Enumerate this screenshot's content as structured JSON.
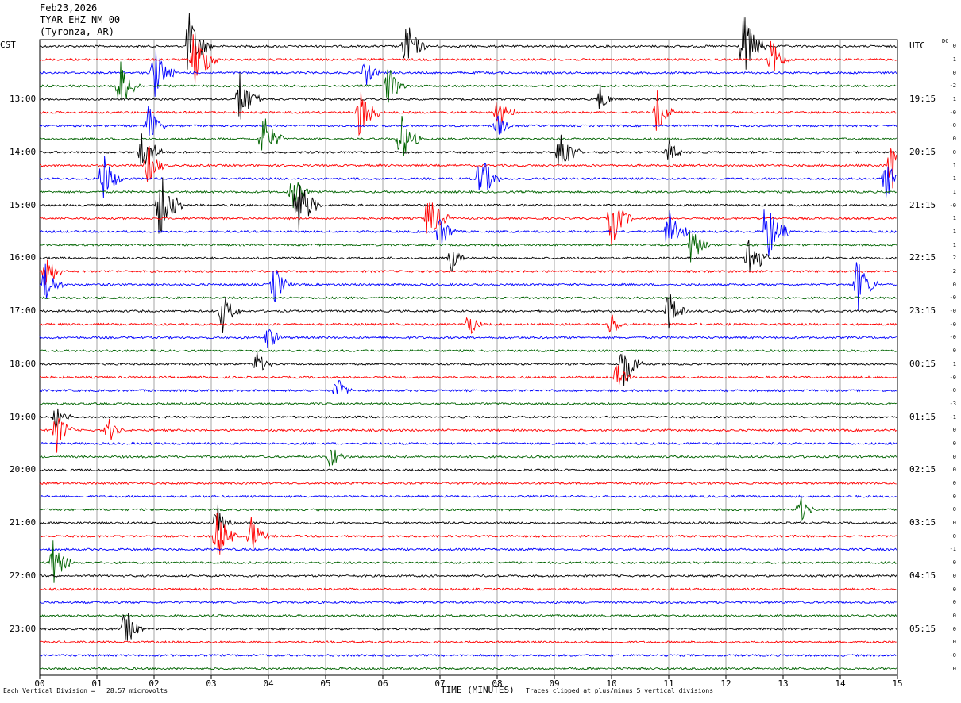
{
  "header": {
    "date": "Feb23,2026",
    "station": "TYAR EHZ NM 00",
    "location": "(Tyronza, AR)"
  },
  "left_tz": "CST",
  "right_tz": "UTC",
  "dc_label": "DC",
  "footer": {
    "scale": "Each Vertical Division =   28.57 microvolts",
    "xaxis_title": "TIME (MINUTES)",
    "clip_note": "Traces clipped at plus/minus 5 vertical divisions"
  },
  "colors": {
    "trace_cycle": [
      "#000000",
      "#ff0000",
      "#0000ff",
      "#006400"
    ],
    "grid": "#808080",
    "frame": "#000000"
  },
  "chart_data": {
    "type": "line",
    "subtype": "helicorder",
    "xlabel": "TIME (MINUTES)",
    "xlim": [
      0,
      15
    ],
    "x_ticks": [
      "00",
      "01",
      "02",
      "03",
      "04",
      "05",
      "06",
      "07",
      "08",
      "09",
      "10",
      "11",
      "12",
      "13",
      "14",
      "15"
    ],
    "rows_per_hour": 4,
    "row_count": 48,
    "left_time_labels": [
      {
        "row": 4,
        "label": "13:00"
      },
      {
        "row": 8,
        "label": "14:00"
      },
      {
        "row": 12,
        "label": "15:00"
      },
      {
        "row": 16,
        "label": "16:00"
      },
      {
        "row": 20,
        "label": "17:00"
      },
      {
        "row": 24,
        "label": "18:00"
      },
      {
        "row": 28,
        "label": "19:00"
      },
      {
        "row": 32,
        "label": "20:00"
      },
      {
        "row": 36,
        "label": "21:00"
      },
      {
        "row": 40,
        "label": "22:00"
      },
      {
        "row": 44,
        "label": "23:00"
      }
    ],
    "right_time_labels": [
      {
        "row": 0,
        "label": "UTC"
      },
      {
        "row": 4,
        "label": "19:15"
      },
      {
        "row": 8,
        "label": "20:15"
      },
      {
        "row": 12,
        "label": "21:15"
      },
      {
        "row": 16,
        "label": "22:15"
      },
      {
        "row": 20,
        "label": "23:15"
      },
      {
        "row": 24,
        "label": "00:15"
      },
      {
        "row": 28,
        "label": "01:15"
      },
      {
        "row": 32,
        "label": "02:15"
      },
      {
        "row": 36,
        "label": "03:15"
      },
      {
        "row": 40,
        "label": "04:15"
      },
      {
        "row": 44,
        "label": "05:15"
      }
    ],
    "dc_offsets": [
      "0",
      "1",
      "0",
      "-2",
      "1",
      "-0",
      "-0",
      "0",
      "0",
      "1",
      "1",
      "1",
      "-0",
      "1",
      "1",
      "1",
      "2",
      "-2",
      "0",
      "-0",
      "-0",
      "-0",
      "-0",
      "0",
      "1",
      "-0",
      "-0",
      "-3",
      "-1",
      "0",
      "0",
      "0",
      "0",
      "0",
      "0",
      "0",
      "0",
      "0",
      "-1",
      "0",
      "0",
      "0",
      "0",
      "0",
      "0",
      "0",
      "-0",
      "0"
    ],
    "events": [
      {
        "row": 0,
        "minute": 2.6,
        "amp": 5
      },
      {
        "row": 0,
        "minute": 6.4,
        "amp": 4
      },
      {
        "row": 0,
        "minute": 12.3,
        "amp": 5
      },
      {
        "row": 1,
        "minute": 2.7,
        "amp": 5
      },
      {
        "row": 1,
        "minute": 12.8,
        "amp": 3
      },
      {
        "row": 2,
        "minute": 2.0,
        "amp": 4
      },
      {
        "row": 2,
        "minute": 5.7,
        "amp": 2
      },
      {
        "row": 3,
        "minute": 1.4,
        "amp": 4
      },
      {
        "row": 3,
        "minute": 6.1,
        "amp": 3
      },
      {
        "row": 4,
        "minute": 3.5,
        "amp": 4
      },
      {
        "row": 4,
        "minute": 9.8,
        "amp": 2
      },
      {
        "row": 5,
        "minute": 5.6,
        "amp": 4
      },
      {
        "row": 5,
        "minute": 8.0,
        "amp": 3
      },
      {
        "row": 5,
        "minute": 10.8,
        "amp": 3
      },
      {
        "row": 6,
        "minute": 1.9,
        "amp": 3
      },
      {
        "row": 6,
        "minute": 8.0,
        "amp": 2
      },
      {
        "row": 7,
        "minute": 3.9,
        "amp": 4
      },
      {
        "row": 7,
        "minute": 6.3,
        "amp": 4
      },
      {
        "row": 8,
        "minute": 1.8,
        "amp": 4
      },
      {
        "row": 8,
        "minute": 9.1,
        "amp": 4
      },
      {
        "row": 8,
        "minute": 11.0,
        "amp": 2
      },
      {
        "row": 9,
        "minute": 1.9,
        "amp": 3
      },
      {
        "row": 9,
        "minute": 14.9,
        "amp": 5
      },
      {
        "row": 10,
        "minute": 1.1,
        "amp": 4
      },
      {
        "row": 10,
        "minute": 7.7,
        "amp": 4
      },
      {
        "row": 10,
        "minute": 14.8,
        "amp": 3
      },
      {
        "row": 11,
        "minute": 4.4,
        "amp": 3
      },
      {
        "row": 12,
        "minute": 2.1,
        "amp": 5
      },
      {
        "row": 12,
        "minute": 4.5,
        "amp": 5
      },
      {
        "row": 13,
        "minute": 6.8,
        "amp": 4
      },
      {
        "row": 13,
        "minute": 10.0,
        "amp": 4
      },
      {
        "row": 14,
        "minute": 7.0,
        "amp": 3
      },
      {
        "row": 14,
        "minute": 11.0,
        "amp": 4
      },
      {
        "row": 14,
        "minute": 12.7,
        "amp": 5
      },
      {
        "row": 15,
        "minute": 11.4,
        "amp": 3
      },
      {
        "row": 16,
        "minute": 7.2,
        "amp": 2
      },
      {
        "row": 16,
        "minute": 12.4,
        "amp": 4
      },
      {
        "row": 17,
        "minute": 0.1,
        "amp": 3
      },
      {
        "row": 18,
        "minute": 0.1,
        "amp": 3
      },
      {
        "row": 18,
        "minute": 4.1,
        "amp": 3
      },
      {
        "row": 18,
        "minute": 14.3,
        "amp": 4
      },
      {
        "row": 20,
        "minute": 3.2,
        "amp": 3
      },
      {
        "row": 20,
        "minute": 11.0,
        "amp": 3
      },
      {
        "row": 21,
        "minute": 7.5,
        "amp": 2
      },
      {
        "row": 21,
        "minute": 10.0,
        "amp": 2
      },
      {
        "row": 22,
        "minute": 4.0,
        "amp": 2
      },
      {
        "row": 24,
        "minute": 10.2,
        "amp": 4
      },
      {
        "row": 24,
        "minute": 3.8,
        "amp": 2
      },
      {
        "row": 25,
        "minute": 10.1,
        "amp": 2
      },
      {
        "row": 26,
        "minute": 5.2,
        "amp": 2
      },
      {
        "row": 28,
        "minute": 0.3,
        "amp": 2
      },
      {
        "row": 29,
        "minute": 0.3,
        "amp": 3
      },
      {
        "row": 29,
        "minute": 1.2,
        "amp": 2
      },
      {
        "row": 31,
        "minute": 5.1,
        "amp": 2
      },
      {
        "row": 35,
        "minute": 13.3,
        "amp": 2
      },
      {
        "row": 36,
        "minute": 3.1,
        "amp": 3
      },
      {
        "row": 37,
        "minute": 3.1,
        "amp": 4
      },
      {
        "row": 37,
        "minute": 3.7,
        "amp": 3
      },
      {
        "row": 39,
        "minute": 0.2,
        "amp": 4
      },
      {
        "row": 44,
        "minute": 1.5,
        "amp": 3
      }
    ]
  }
}
